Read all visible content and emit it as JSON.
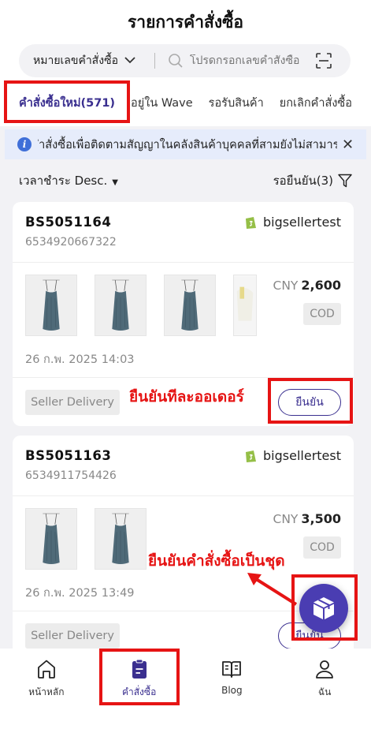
{
  "header": {
    "title": "รายการคำสั่งซื้อ",
    "search_type": "หมายเลขคำสั่งซื้อ",
    "search_placeholder": "โปรดกรอกเลขคำสั่งซื้อ"
  },
  "tabs": [
    {
      "label": "คำสั่งซื้อใหม่(571)"
    },
    {
      "label": "อยู่ใน Wave"
    },
    {
      "label": "รอรับสินค้า"
    },
    {
      "label": "ยกเลิกคำสั่งซื้อ"
    }
  ],
  "notice": {
    "text": "ก่อนส่งต่อคำสั่งซื้อเพื่อติดตามสัญญาในคลังสินค้าบุคคลที่สามยังไม่สามารถ"
  },
  "sortbar": {
    "sort_label": "เวลาชำระ Desc.",
    "pending_label": "รอยืนยัน(3)"
  },
  "orders": [
    {
      "order_no": "BS5051164",
      "platform_no": "6534920667322",
      "shop": "bigsellertest",
      "currency": "CNY",
      "amount": "2,600",
      "payment": "COD",
      "date": "26 ก.พ. 2025 14:03",
      "delivery": "Seller Delivery",
      "confirm_label": "ยืนยัน"
    },
    {
      "order_no": "BS5051163",
      "platform_no": "6534911754426",
      "shop": "bigsellertest",
      "currency": "CNY",
      "amount": "3,500",
      "payment": "COD",
      "date": "26 ก.พ. 2025 13:49",
      "delivery": "Seller Delivery",
      "confirm_label": "ยืนยัน"
    }
  ],
  "annotations": {
    "confirm_each": "ยืนยันทีละออเดอร์",
    "confirm_batch": "ยืนยันคำสั่งซื้อเป็นชุด"
  },
  "bottom_nav": [
    {
      "label": "หน้าหลัก",
      "icon": "home-icon"
    },
    {
      "label": "คำสั่งซื้อ",
      "icon": "clipboard-icon"
    },
    {
      "label": "Blog",
      "icon": "book-icon"
    },
    {
      "label": "ฉัน",
      "icon": "user-icon"
    }
  ],
  "colors": {
    "accent": "#3a2f8f",
    "annotation": "#e61414",
    "fab": "#4a3db2"
  }
}
